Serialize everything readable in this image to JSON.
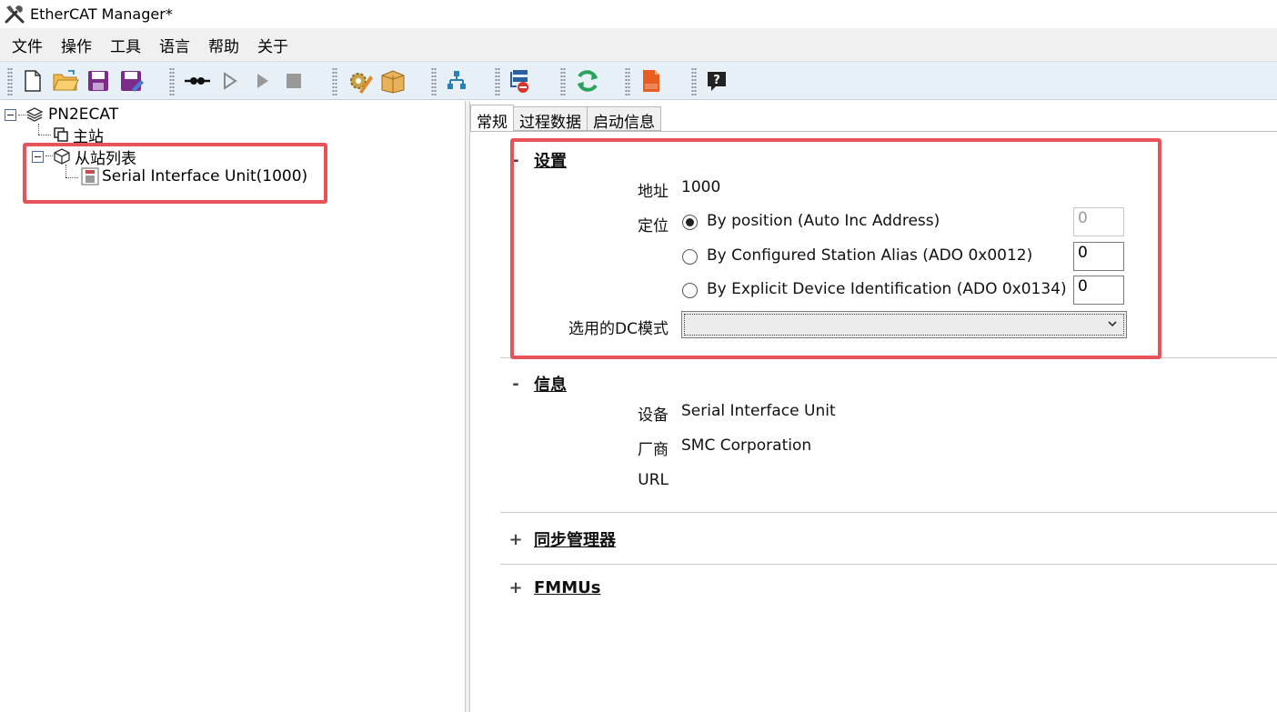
{
  "window": {
    "title": "EtherCAT Manager*"
  },
  "menu": [
    "文件",
    "操作",
    "工具",
    "语言",
    "帮助",
    "关于"
  ],
  "toolbar_icons": [
    "new-file-icon",
    "open-folder-icon",
    "save-icon",
    "save-as-icon",
    "connect-icon",
    "play-outline-icon",
    "play-icon",
    "stop-icon",
    "settings-edit-icon",
    "package-icon",
    "network-tree-icon",
    "config-stop-icon",
    "refresh-icon",
    "esi-icon",
    "help-icon"
  ],
  "tree": {
    "root": "PN2ECAT",
    "master": "主站",
    "slave_list": "从站列表",
    "slave_item": "Serial Interface Unit(1000)"
  },
  "tabs": [
    "常规",
    "过程数据",
    "启动信息"
  ],
  "settings": {
    "title": "设置",
    "sign": "-",
    "address_label": "地址",
    "address_value": "1000",
    "position_label": "定位",
    "options": [
      {
        "label": "By position (Auto Inc Address)",
        "checked": true,
        "value": "0",
        "enabled": false
      },
      {
        "label": "By Configured Station Alias (ADO 0x0012)",
        "checked": false,
        "value": "0",
        "enabled": true
      },
      {
        "label": "By Explicit Device Identification (ADO 0x0134)",
        "checked": false,
        "value": "0",
        "enabled": true
      }
    ],
    "dc_label": "选用的DC模式",
    "dc_value": ""
  },
  "info": {
    "title": "信息",
    "sign": "-",
    "device_label": "设备",
    "device_value": "Serial Interface Unit",
    "vendor_label": "厂商",
    "vendor_value": "SMC Corporation",
    "url_label": "URL"
  },
  "sync": {
    "title": "同步管理器",
    "sign": "+"
  },
  "fmmu": {
    "title": "FMMUs",
    "sign": "+"
  },
  "colors": {
    "highlight": "#e8535a",
    "toolbar_bg": "#e8f0f7"
  }
}
